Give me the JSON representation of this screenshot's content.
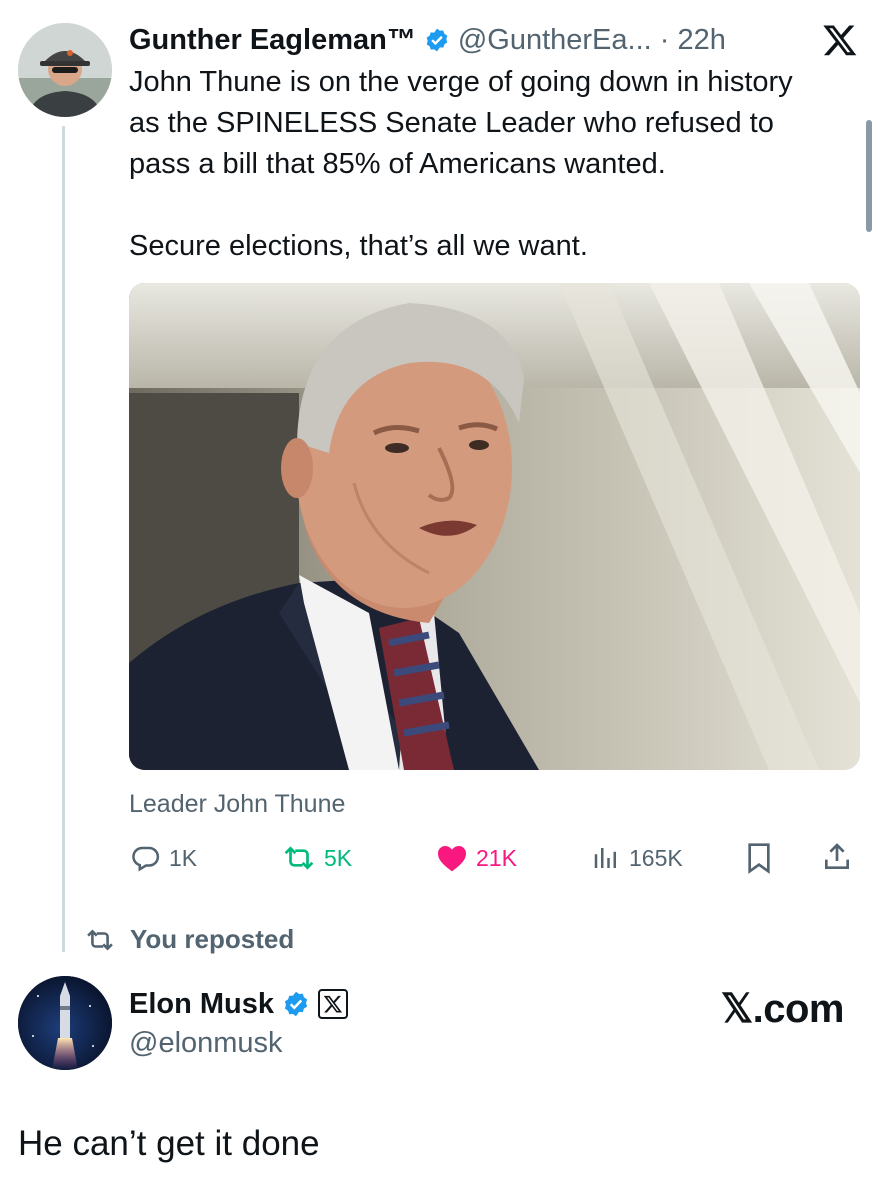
{
  "original_tweet": {
    "display_name": "Gunther Eagleman™",
    "handle_time": "@GuntherEa... · 22h",
    "lines": [
      "John Thune is on the verge of going down in history",
      "as the SPINELESS Senate Leader who refused to",
      "pass a bill that 85% of Americans wanted.",
      "Secure elections, that’s all we want."
    ],
    "media_caption": "Leader John Thune",
    "replies": "1K",
    "reposts": "5K",
    "likes": "21K",
    "views": "165K"
  },
  "repost_indicator": "You reposted",
  "reply_author": {
    "display_name": "Elon Musk",
    "handle": "@elonmusk",
    "link_badge": "𝕏.com"
  },
  "reply_text": "He can’t get it done",
  "colors": {
    "verified": "#1d9bf0",
    "repost_green": "#00ba7c",
    "like_pink": "#f91880",
    "secondary": "#536471",
    "thread_line": "#cfd9de"
  },
  "icons": [
    "verified-badge-icon",
    "x-logo-icon",
    "reply-icon",
    "repost-icon",
    "heart-icon",
    "views-icon",
    "bookmark-icon",
    "share-icon"
  ]
}
